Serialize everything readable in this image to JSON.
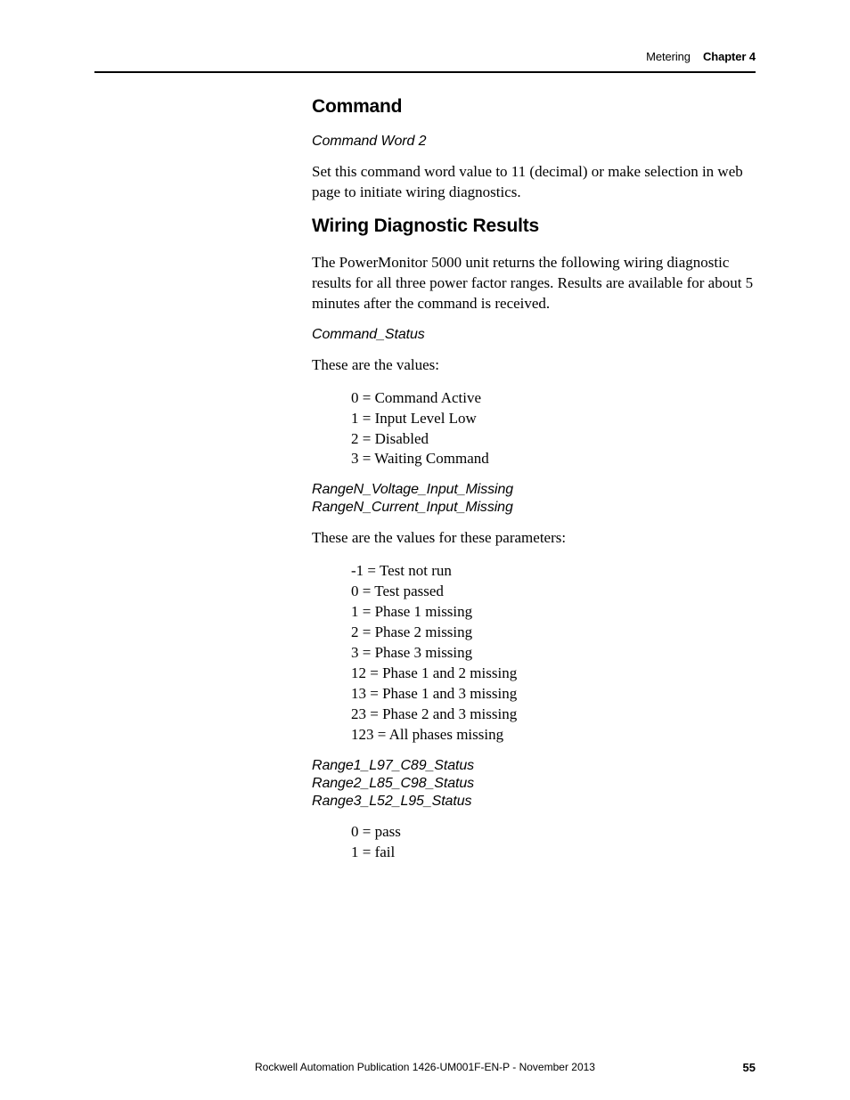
{
  "header": {
    "section": "Metering",
    "chapter": "Chapter 4"
  },
  "sections": {
    "command": {
      "title": "Command",
      "subtitle": "Command Word 2",
      "body": "Set this command word value to 11 (decimal) or make selection in web page to initiate wiring diagnostics."
    },
    "wiring": {
      "title": "Wiring Diagnostic Results",
      "intro": "The PowerMonitor 5000 unit returns the following wiring diagnostic results for all three power factor ranges. Results are available for about 5 minutes after the command is received.",
      "cmdstatus": {
        "label": "Command_Status",
        "lead": "These are the values:",
        "values": [
          "0 = Command Active",
          "1 = Input Level Low",
          "2 = Disabled",
          "3 = Waiting Command"
        ]
      },
      "rangen": {
        "label1": "RangeN_Voltage_Input_Missing",
        "label2": "RangeN_Current_Input_Missing",
        "lead": "These are the values for these parameters:",
        "values": [
          "-1 = Test not run",
          "0 = Test passed",
          "1 = Phase 1 missing",
          "2 = Phase 2 missing",
          "3 = Phase 3 missing",
          "12 = Phase 1 and 2 missing",
          "13 = Phase 1 and 3 missing",
          "23 = Phase 2 and 3 missing",
          "123 = All phases missing"
        ]
      },
      "rangestatus": {
        "label1": "Range1_L97_C89_Status",
        "label2": "Range2_L85_C98_Status",
        "label3": "Range3_L52_L95_Status",
        "values": [
          "0 = pass",
          "1 = fail"
        ]
      }
    }
  },
  "footer": {
    "publication": "Rockwell Automation Publication 1426-UM001F-EN-P - November 2013",
    "page": "55"
  }
}
